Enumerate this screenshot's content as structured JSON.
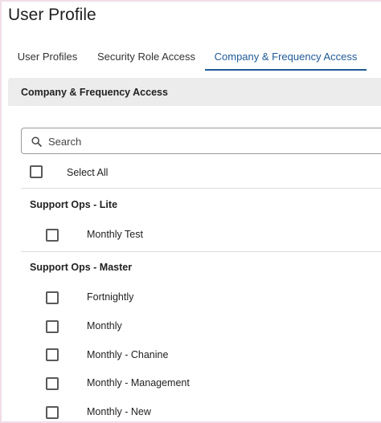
{
  "page": {
    "title": "User Profile"
  },
  "tabs": [
    {
      "label": "User Profiles",
      "active": false
    },
    {
      "label": "Security Role Access",
      "active": false
    },
    {
      "label": "Company & Frequency Access",
      "active": true
    }
  ],
  "panel": {
    "title": "Company & Frequency Access"
  },
  "search": {
    "placeholder": "Search",
    "value": ""
  },
  "select_all": {
    "label": "Select All",
    "checked": false
  },
  "groups": [
    {
      "title": "Support Ops - Lite",
      "items": [
        {
          "label": "Monthly Test",
          "checked": false
        }
      ]
    },
    {
      "title": "Support Ops - Master",
      "items": [
        {
          "label": "Fortnightly",
          "checked": false
        },
        {
          "label": "Monthly",
          "checked": false
        },
        {
          "label": "Monthly - Chanine",
          "checked": false
        },
        {
          "label": "Monthly - Management",
          "checked": false
        },
        {
          "label": "Monthly - New",
          "checked": false
        }
      ]
    }
  ],
  "colors": {
    "accent": "#1f5a96",
    "header_bg": "#ececec",
    "frame": "#f1dde8"
  },
  "icons": {
    "search": "search-icon"
  }
}
